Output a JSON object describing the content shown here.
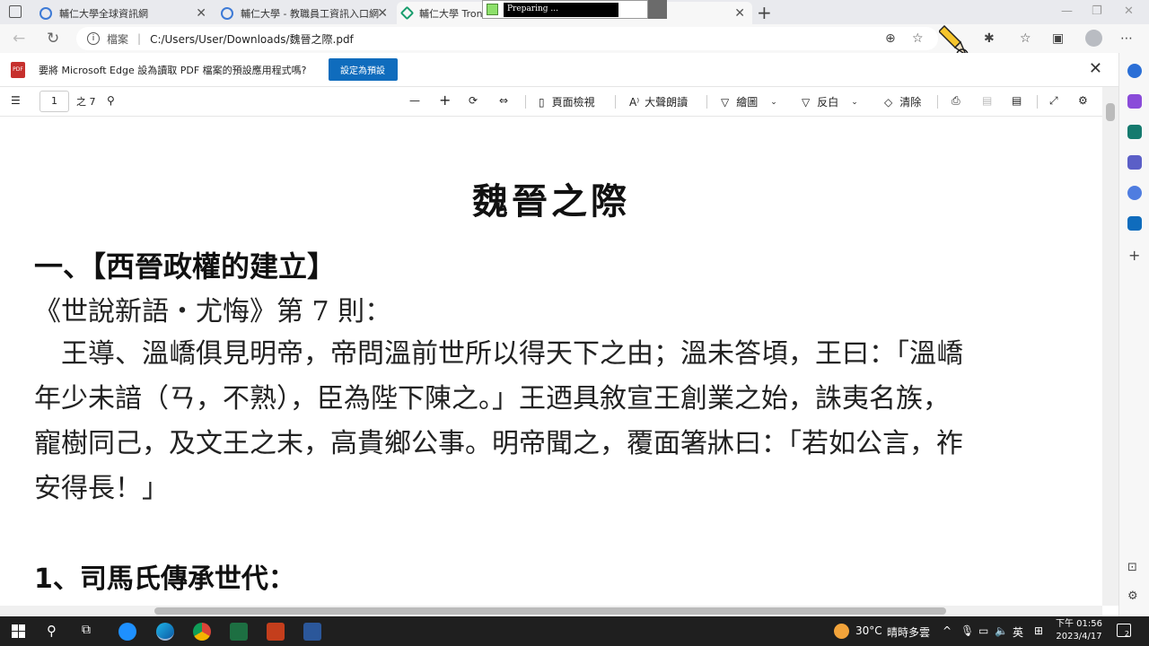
{
  "browser": {
    "tabs": [
      {
        "title": "輔仁大學全球資訊網"
      },
      {
        "title": "輔仁大學 - 教職員工資訊入口網"
      },
      {
        "title": "輔仁大學 TronC"
      }
    ],
    "overlay": {
      "label": "Preparing ..."
    },
    "address": {
      "scheme_label": "檔案",
      "url": "C:/Users/User/Downloads/魏晉之際.pdf"
    }
  },
  "infobar": {
    "pdf_badge": "PDF",
    "message": "要將 Microsoft Edge 設為讀取 PDF 檔案的預設應用程式嗎?",
    "button_label": "設定為預設"
  },
  "pdf_toolbar": {
    "page_value": "1",
    "page_total": "之 7",
    "page_view": "頁面檢視",
    "read_aloud": "大聲朗讀",
    "draw": "繪圖",
    "highlight": "反白",
    "erase": "清除"
  },
  "document": {
    "title": "魏晉之際",
    "heading1": "一、【西晉政權的建立】",
    "reference": "《世說新語・尤悔》第 7 則：",
    "paragraph_lines": [
      "　王導、溫嶠俱見明帝，帝問溫前世所以得天下之由；溫未答頃，王曰：「溫嶠",
      "年少未諳（ㄢ，不熟），臣為陛下陳之。」王迺具敘宣王創業之始，誅夷名族，",
      "寵樹同己，及文王之末，高貴鄉公事。明帝聞之，覆面箸牀曰：「若如公言，祚",
      "安得長！」"
    ],
    "heading2": "1、司馬氏傳承世代："
  },
  "taskbar": {
    "weather": "30°C",
    "weather_desc": "晴時多雲",
    "ime": "英",
    "time": "下午 01:56",
    "date": "2023/4/17",
    "notification_count": "2"
  },
  "colors": {
    "accent": "#0f6cbd",
    "pdf_red": "#c6302d",
    "taskbar": "#1f1f1f"
  }
}
